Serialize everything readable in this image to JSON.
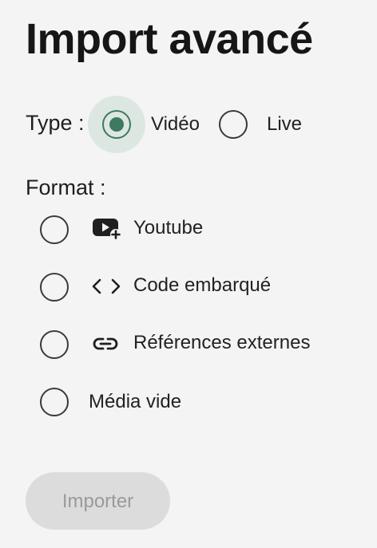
{
  "title": "Import avancé",
  "type_section": {
    "label": "Type :",
    "options": [
      {
        "label": "Vidéo",
        "checked": true
      },
      {
        "label": "Live",
        "checked": false
      }
    ]
  },
  "format_section": {
    "label": "Format :",
    "options": [
      {
        "label": "Youtube",
        "icon": "youtube-add-icon",
        "checked": false
      },
      {
        "label": "Code embarqué",
        "icon": "code-icon",
        "checked": false
      },
      {
        "label": "Références externes",
        "icon": "link-icon",
        "checked": false
      },
      {
        "label": "Média vide",
        "icon": "",
        "checked": false
      }
    ]
  },
  "actions": {
    "import_label": "Importer",
    "import_disabled": true
  },
  "colors": {
    "accent": "#3d7a5f",
    "background": "#f4f4f4",
    "disabled_bg": "#dcdcdc",
    "disabled_text": "#9a9a9a"
  }
}
